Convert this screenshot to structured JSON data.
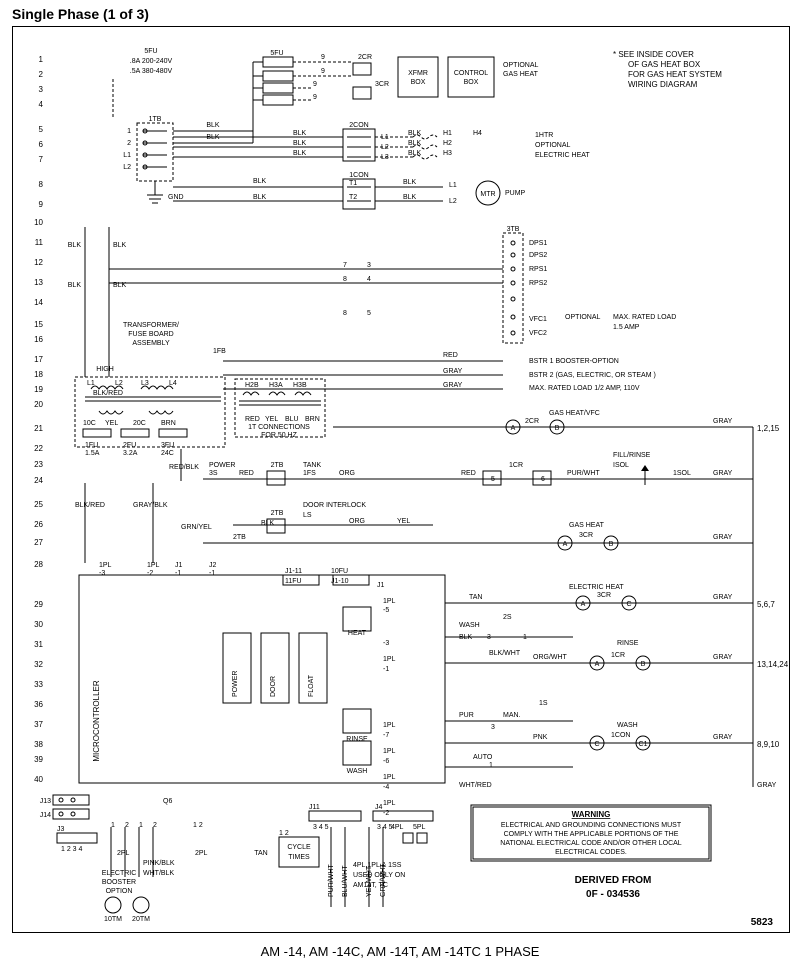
{
  "title": "Single Phase (1 of 3)",
  "caption": "AM -14, AM -14C, AM -14T, AM -14TC 1 PHASE",
  "pageCode": "5823",
  "rows": [
    "1",
    "2",
    "3",
    "4",
    "5",
    "6",
    "7",
    "8",
    "9",
    "10",
    "11",
    "12",
    "13",
    "14",
    "15",
    "16",
    "17",
    "18",
    "19",
    "20",
    "21",
    "22",
    "23",
    "24",
    "25",
    "26",
    "27",
    "28",
    "29",
    "30",
    "31",
    "32",
    "33",
    "36",
    "37",
    "38",
    "39",
    "40"
  ],
  "rowRefs": {
    "r21": "1,2,15",
    "r30": "5,6,7",
    "r33": "13,14,24",
    "r38": "8,9,10"
  },
  "power": {
    "header": "5FU",
    "line1": ".8A 200-240V",
    "line2": ".5A 380-480V"
  },
  "topNote": {
    "l1": "* SEE INSIDE COVER",
    "l2": "OF GAS HEAT BOX",
    "l3": "FOR GAS HEAT SYSTEM",
    "l4": "WIRING DIAGRAM"
  },
  "labels": {
    "tb1": "1TB",
    "gnd": "GND",
    "fuse5": "5FU",
    "pt9": "9",
    "cr2": "2CR",
    "cr3": "3CR",
    "xfmr1": "XFMR",
    "xfmr2": "BOX",
    "control1": "CONTROL",
    "control2": "BOX",
    "optional": "OPTIONAL",
    "gasHeat": "GAS HEAT",
    "con2": "2CON",
    "h1": "H1",
    "h2": "H2",
    "h3": "H3",
    "h4": "H4",
    "thermo1": "1HTR",
    "elecHeat": "ELECTRIC HEAT",
    "con1": "1CON",
    "mtr": "MTR",
    "pump": "PUMP",
    "tb3": "3TB",
    "icr7": "7",
    "icr8": "8",
    "cr2s": "8",
    "xfrmAssy1": "TRANSFORMER/",
    "xfrmAssy2": "FUSE BOARD",
    "xfrmAssy3": "ASSEMBLY",
    "fb1": "1FB",
    "high": "HIGH",
    "fu1": "1FU",
    "fu2": "2FU",
    "fu3": "3FU",
    "a15": "1.5A",
    "a32": "3.2A",
    "a24c": "24C",
    "h2b": "H2B",
    "h3a": "H3A",
    "h3b": "H3B",
    "itconn": "1T CONNECTIONS",
    "hz50": "FOR 50 HZ",
    "power3s": "3S",
    "power": "POWER",
    "tb2": "2TB",
    "tank": "TANK",
    "ifs": "1FS",
    "icr": "1CR",
    "fillRinse": "FILL/RINSE",
    "isol": "ISOL",
    "isol2": "1SOL",
    "doorInt": "DOOR INTERLOCK",
    "ls": "LS",
    "gasHeatLbl": "GAS HEAT",
    "fu10l": "10FU",
    "fu11l": "11FU",
    "micro": "MICROCONTROLLER",
    "door": "DOOR",
    "float": "FLOAT",
    "heat": "HEAT",
    "rinse": "RINSE",
    "wash": "WASH",
    "ipl": "1PL",
    "tan": "TAN",
    "elecHeatLbl": "ELECTRIC HEAT",
    "s2": "2S",
    "s1": "1S",
    "man": "MAN.",
    "auto": "AUTO",
    "con1s": "1CON",
    "pl2": "2PL",
    "elecBoost1": "ELECTRIC",
    "elecBoost2": "BOOSTER",
    "elecBoost3": "OPTION",
    "tm10": "10TM",
    "tm20": "20TM",
    "cycle1": "CYCLE",
    "cycle2": "TIMES",
    "pl4": "4PL",
    "pl5": "5PL",
    "pl4note1": "4PL,1PL & 1SS",
    "pl4note2": "USED ONLY ON",
    "pl4note3": "AM14T, TC"
  },
  "tb3": {
    "dps1": "DPS1",
    "dps2": "DPS2",
    "rps1": "RPS1",
    "rps2": "RPS2",
    "vfc1": "VFC1",
    "vfc2": "VFC2"
  },
  "rightNotes": {
    "maxLoad1": "MAX. RATED LOAD",
    "maxLoad2": "1.5 AMP",
    "bstr1": "BSTR 1 BOOSTER-OPTION",
    "bstr2": "BSTR 2 (GAS, ELECTRIC, OR STEAM )",
    "bstr3": "MAX. RATED LOAD 1/2 AMP, 110V",
    "gasVfc": "GAS HEAT/VFC"
  },
  "colors": {
    "blk": "BLK",
    "red": "RED",
    "gray": "GRAY",
    "org": "ORG",
    "yel": "YEL",
    "blu": "BLU",
    "brn": "BRN",
    "pur": "PUR",
    "pnk": "PNK",
    "blkRed": "BLK/RED",
    "redBlk": "RED/BLK",
    "grayBlk": "GRAY/BLK",
    "grnYel": "GRN/YEL",
    "purWht": "PUR/WHT",
    "orgWht": "ORG/WHT",
    "blkWht": "BLK/WHT",
    "whtRed": "WHT/RED",
    "pnkBlk": "PINK/BLK",
    "whtBlk": "WHT/BLK",
    "bluWht": "BLU/WHT",
    "yelWht": "YEL/WHT",
    "grnWht": "GRN/WHT"
  },
  "warning": {
    "title": "WARNING",
    "l1": "ELECTRICAL AND GROUNDING CONNECTIONS MUST",
    "l2": "COMPLY WITH THE APPLICABLE PORTIONS OF THE",
    "l3": "NATIONAL ELECTRICAL CODE AND/OR OTHER LOCAL",
    "l4": "ELECTRICAL CODES."
  },
  "derived": {
    "l1": "DERIVED FROM",
    "l2": "0F - 034536"
  }
}
